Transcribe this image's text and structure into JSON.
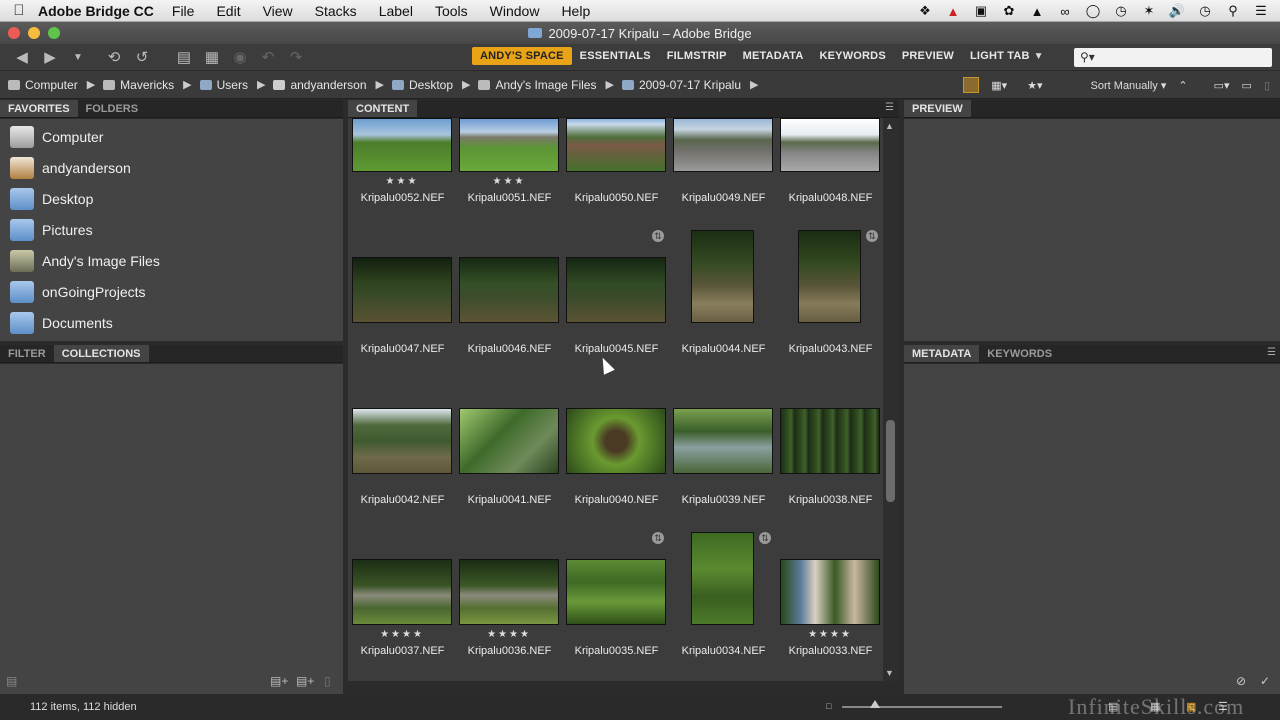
{
  "menubar": {
    "app_name": "Adobe Bridge CC",
    "items": [
      "File",
      "Edit",
      "View",
      "Stacks",
      "Label",
      "Tools",
      "Window",
      "Help"
    ]
  },
  "window": {
    "title": "2009-07-17 Kripalu – Adobe Bridge"
  },
  "workspaces": [
    "ANDY'S SPACE",
    "ESSENTIALS",
    "FILMSTRIP",
    "METADATA",
    "KEYWORDS",
    "PREVIEW",
    "LIGHT TAB"
  ],
  "active_workspace": "ANDY'S SPACE",
  "breadcrumbs": [
    "Computer",
    "Mavericks",
    "Users",
    "andyanderson",
    "Desktop",
    "Andy's Image Files",
    "2009-07-17 Kripalu"
  ],
  "sort_label": "Sort Manually",
  "left_top_tabs": [
    "FAVORITES",
    "FOLDERS"
  ],
  "favorites": [
    {
      "label": "Computer",
      "icon": "computer-icon"
    },
    {
      "label": "andyanderson",
      "icon": "home-icon"
    },
    {
      "label": "Desktop",
      "icon": "folder-icon"
    },
    {
      "label": "Pictures",
      "icon": "folder-icon"
    },
    {
      "label": "Andy's Image Files",
      "icon": "image-folder-icon"
    },
    {
      "label": "onGoingProjects",
      "icon": "folder-icon"
    },
    {
      "label": "Documents",
      "icon": "folder-icon"
    }
  ],
  "left_bottom_tabs": [
    "FILTER",
    "COLLECTIONS"
  ],
  "content_tab": "CONTENT",
  "preview_tab": "PREVIEW",
  "right_bottom_tabs": [
    "METADATA",
    "KEYWORDS"
  ],
  "thumbnails": [
    {
      "name": "Kripalu0052.NEF",
      "rating": "★★★"
    },
    {
      "name": "Kripalu0051.NEF",
      "rating": "★★★"
    },
    {
      "name": "Kripalu0050.NEF",
      "rating": ""
    },
    {
      "name": "Kripalu0049.NEF",
      "rating": ""
    },
    {
      "name": "Kripalu0048.NEF",
      "rating": ""
    },
    {
      "name": "Kripalu0047.NEF",
      "rating": ""
    },
    {
      "name": "Kripalu0046.NEF",
      "rating": ""
    },
    {
      "name": "Kripalu0045.NEF",
      "rating": ""
    },
    {
      "name": "Kripalu0044.NEF",
      "rating": ""
    },
    {
      "name": "Kripalu0043.NEF",
      "rating": ""
    },
    {
      "name": "Kripalu0042.NEF",
      "rating": ""
    },
    {
      "name": "Kripalu0041.NEF",
      "rating": ""
    },
    {
      "name": "Kripalu0040.NEF",
      "rating": ""
    },
    {
      "name": "Kripalu0039.NEF",
      "rating": ""
    },
    {
      "name": "Kripalu0038.NEF",
      "rating": ""
    },
    {
      "name": "Kripalu0037.NEF",
      "rating": "★★★★"
    },
    {
      "name": "Kripalu0036.NEF",
      "rating": "★★★★"
    },
    {
      "name": "Kripalu0035.NEF",
      "rating": ""
    },
    {
      "name": "Kripalu0034.NEF",
      "rating": ""
    },
    {
      "name": "Kripalu0033.NEF",
      "rating": "★★★★"
    }
  ],
  "status": {
    "items": "112 items, 112 hidden"
  },
  "watermark": "InfiniteSkills.com"
}
